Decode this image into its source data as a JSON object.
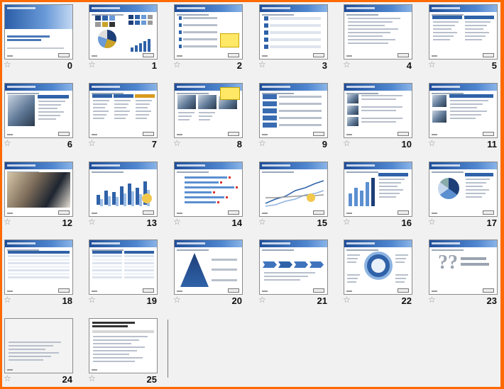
{
  "slides": [
    {
      "number": "0",
      "layout": "title"
    },
    {
      "number": "1",
      "layout": "colors-chart"
    },
    {
      "number": "2",
      "layout": "agenda-note"
    },
    {
      "number": "3",
      "layout": "agenda"
    },
    {
      "number": "4",
      "layout": "text"
    },
    {
      "number": "5",
      "layout": "two-columns"
    },
    {
      "number": "6",
      "layout": "image-text"
    },
    {
      "number": "7",
      "layout": "three-columns"
    },
    {
      "number": "8",
      "layout": "images-note"
    },
    {
      "number": "9",
      "layout": "sidebar-list"
    },
    {
      "number": "10",
      "layout": "image-rows"
    },
    {
      "number": "11",
      "layout": "image-rows-2"
    },
    {
      "number": "12",
      "layout": "photo"
    },
    {
      "number": "13",
      "layout": "bar-chart"
    },
    {
      "number": "14",
      "layout": "hbar-chart"
    },
    {
      "number": "15",
      "layout": "line-chart"
    },
    {
      "number": "16",
      "layout": "chart-text"
    },
    {
      "number": "17",
      "layout": "pie-text"
    },
    {
      "number": "18",
      "layout": "table"
    },
    {
      "number": "19",
      "layout": "table-2"
    },
    {
      "number": "20",
      "layout": "pyramid"
    },
    {
      "number": "21",
      "layout": "process"
    },
    {
      "number": "22",
      "layout": "cycle"
    },
    {
      "number": "23",
      "layout": "questions"
    },
    {
      "number": "24",
      "layout": "blank-notes"
    },
    {
      "number": "25",
      "layout": "document"
    }
  ],
  "icons": {
    "star": "☆"
  },
  "colors": {
    "accent": "#ff6a00",
    "slide_bar": "#2f62a8",
    "background": "#f1f1f1"
  }
}
